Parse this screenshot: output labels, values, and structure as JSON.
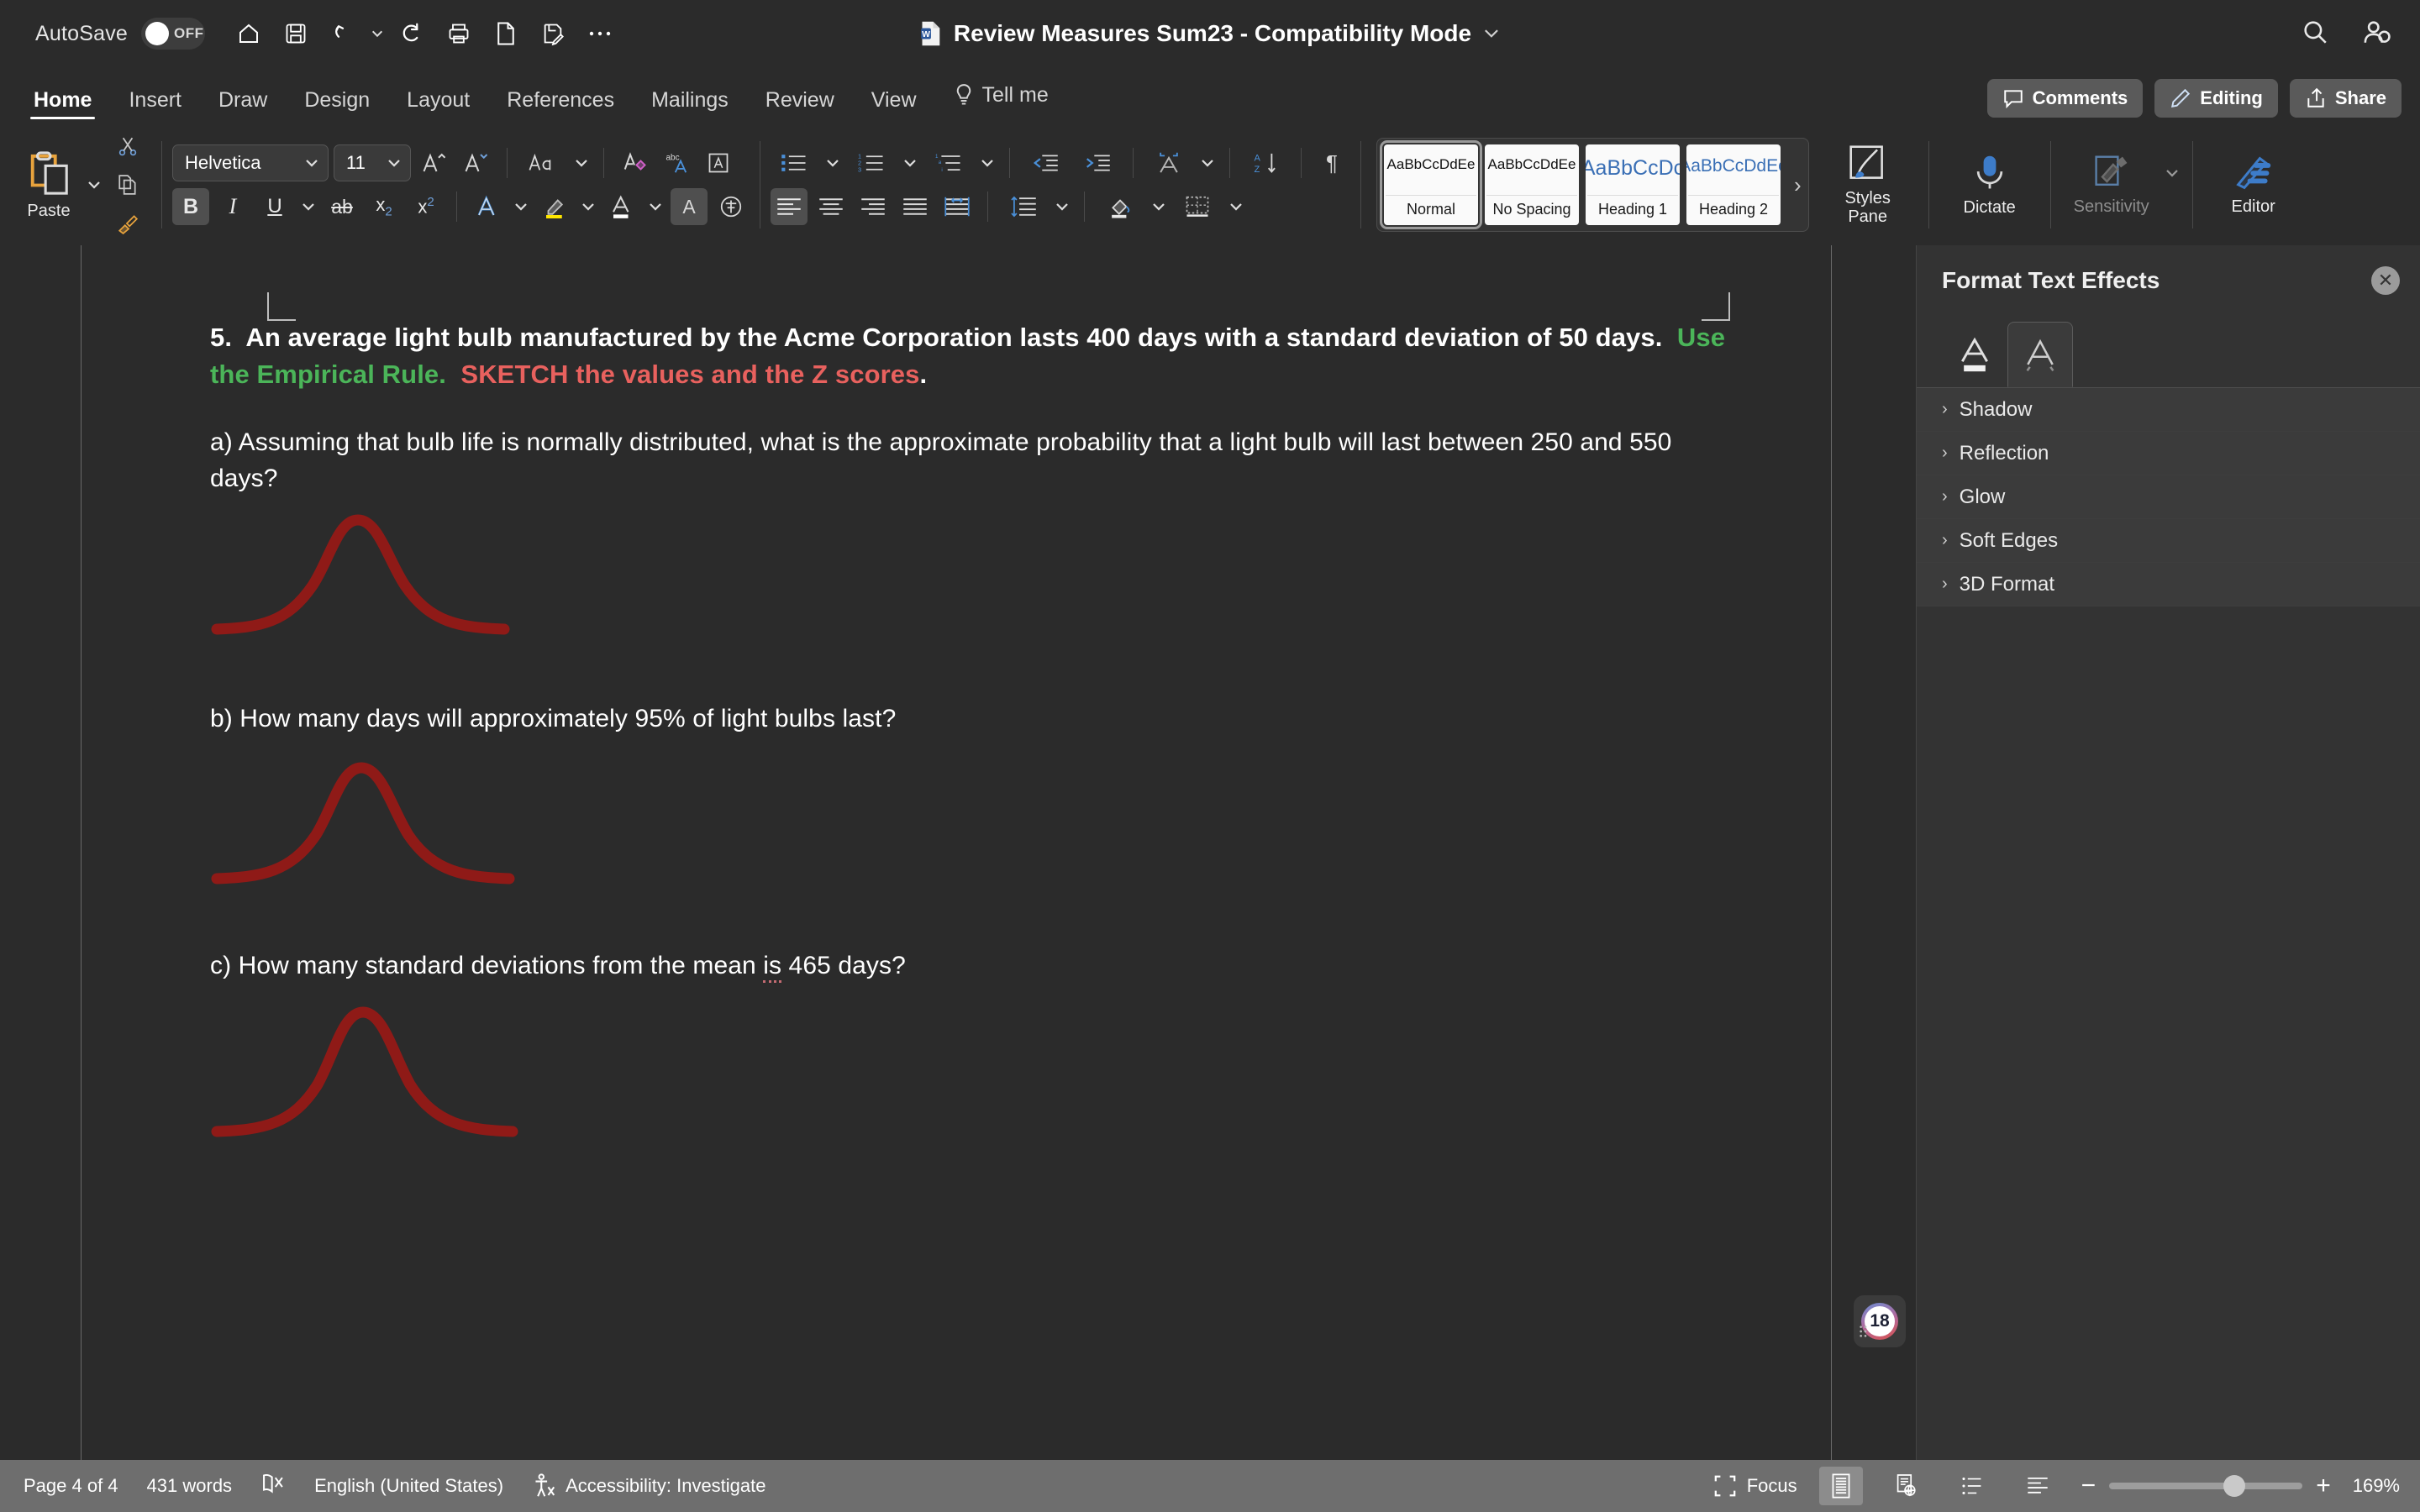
{
  "titlebar": {
    "autosave_label": "AutoSave",
    "autosave_state": "OFF",
    "doc_title": "Review Measures Sum23  -  Compatibility Mode",
    "quick_access": [
      {
        "name": "home-icon",
        "tip": "Home"
      },
      {
        "name": "save-icon",
        "tip": "Save"
      },
      {
        "name": "undo-icon",
        "tip": "Undo"
      },
      {
        "name": "redo-icon",
        "tip": "Redo"
      },
      {
        "name": "print-icon",
        "tip": "Print"
      },
      {
        "name": "new-document-icon",
        "tip": "New"
      },
      {
        "name": "save-as-icon",
        "tip": "Save As"
      },
      {
        "name": "more-options-icon",
        "tip": "More"
      }
    ],
    "search_icon": "search-icon",
    "account_icon": "account-icon"
  },
  "tabs": [
    {
      "label": "Home",
      "active": true
    },
    {
      "label": "Insert",
      "active": false
    },
    {
      "label": "Draw",
      "active": false
    },
    {
      "label": "Design",
      "active": false
    },
    {
      "label": "Layout",
      "active": false
    },
    {
      "label": "References",
      "active": false
    },
    {
      "label": "Mailings",
      "active": false
    },
    {
      "label": "Review",
      "active": false
    },
    {
      "label": "View",
      "active": false
    },
    {
      "label": "Tell me",
      "active": false
    }
  ],
  "tabbar_buttons": {
    "comments": "Comments",
    "editing": "Editing",
    "share": "Share"
  },
  "ribbon": {
    "paste_label": "Paste",
    "font_name": "Helvetica",
    "font_size": "11",
    "bold_active": true,
    "align_left_active": true,
    "styles": [
      {
        "preview": "AaBbCcDdEe",
        "name": "Normal",
        "selected": true,
        "kind": "normal"
      },
      {
        "preview": "AaBbCcDdEe",
        "name": "No Spacing",
        "selected": false,
        "kind": "normal"
      },
      {
        "preview": "AaBbCcDc",
        "name": "Heading 1",
        "selected": false,
        "kind": "h1"
      },
      {
        "preview": "AaBbCcDdEe",
        "name": "Heading 2",
        "selected": false,
        "kind": "h2"
      }
    ],
    "gallery_more": "›",
    "styles_pane_label": "Styles\nPane",
    "styles_pane_l1": "Styles",
    "styles_pane_l2": "Pane",
    "dictate_label": "Dictate",
    "sensitivity_label": "Sensitivity",
    "editor_label": "Editor"
  },
  "pane": {
    "title": "Format Text Effects",
    "close": "✕",
    "tabs": [
      {
        "name": "text-fill-outline-tab",
        "active": false
      },
      {
        "name": "text-effects-tab",
        "active": true
      }
    ],
    "sections": [
      {
        "label": "Shadow"
      },
      {
        "label": "Reflection"
      },
      {
        "label": "Glow"
      },
      {
        "label": "Soft Edges"
      },
      {
        "label": "3D Format"
      }
    ]
  },
  "document": {
    "question_number": "5.",
    "q5_part1": "An average light bulb manufactured by the Acme Corporation lasts 400 days with a standard deviation of 50 days.",
    "q5_green": "Use the Empirical Rule",
    "q5_dot1": ".",
    "q5_red": "SKETCH the values and the Z scores",
    "q5_dot2": ".",
    "part_a": "a) Assuming that bulb life is normally distributed, what is the approximate probability that a light bulb will last between 250 and 550 days?",
    "part_b": "b) How many days will approximately 95% of light bulbs last?",
    "part_c_pre": "c) How many standard deviations from the mean ",
    "part_c_err": "is",
    "part_c_post": " 465 days?",
    "curve_color": "#8f1a17",
    "comment_badge": "18"
  },
  "status": {
    "page": "Page 4 of 4",
    "words": "431 words",
    "proofing_icon": "proofing-errors-icon",
    "language": "English (United States)",
    "accessibility": "Accessibility: Investigate",
    "focus": "Focus",
    "zoom": "169%",
    "zoom_out": "−",
    "zoom_in": "+"
  }
}
